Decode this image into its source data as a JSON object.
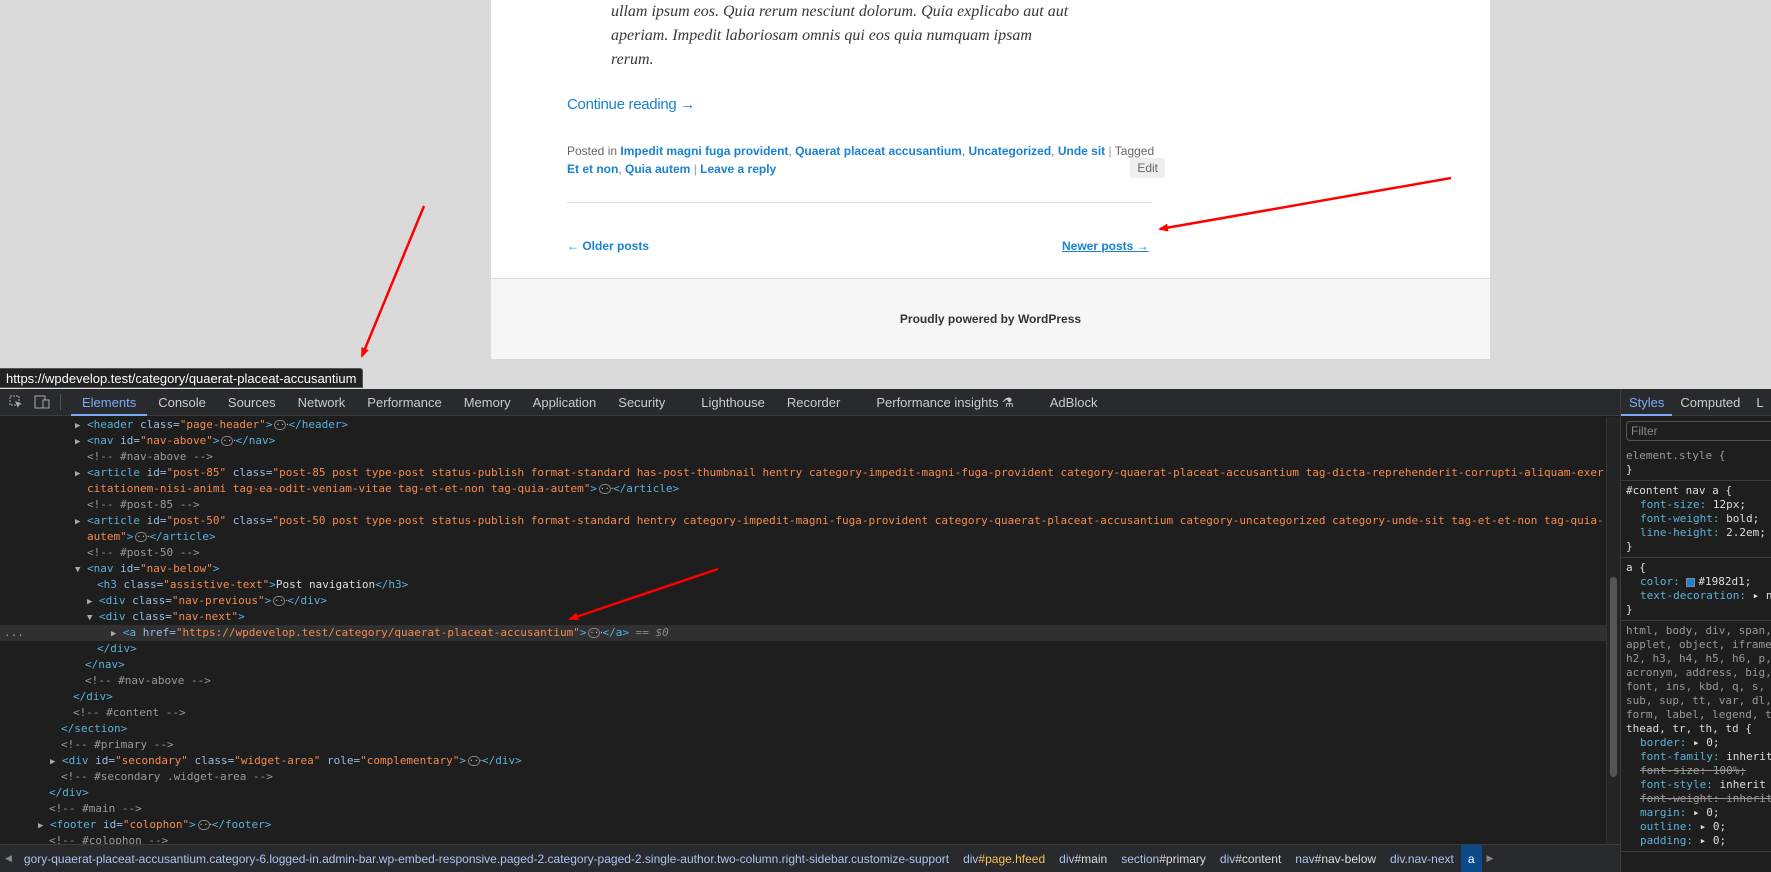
{
  "page": {
    "excerpt_lines": [
      "ullam ipsum eos. Quia rerum nesciunt dolorum. Quia explicabo aut aut",
      "aperiam. Impedit laboriosam omnis qui eos quia numquam ipsam",
      "rerum."
    ],
    "continue_reading": "Continue reading →",
    "meta": {
      "posted_in_label": "Posted in",
      "categories": [
        "Impedit magni fuga provident",
        "Quaerat placeat accusantium",
        "Uncategorized",
        "Unde sit"
      ],
      "tagged_label": "Tagged",
      "tags": [
        "Et et non",
        "Quia autem"
      ],
      "separator": "|",
      "leave_reply": "Leave a reply",
      "edit": "Edit"
    },
    "older_posts": "← Older posts",
    "newer_posts": "Newer posts →",
    "footer_text": "Proudly powered by WordPress",
    "link_color": "#1982d1"
  },
  "tooltip_url": "https://wpdevelop.test/category/quaerat-placeat-accusantium",
  "devtools": {
    "tabs": [
      "Elements",
      "Console",
      "Sources",
      "Network",
      "Performance",
      "Memory",
      "Application",
      "Security",
      "Lighthouse",
      "Recorder",
      "Performance insights",
      "AdBlock"
    ],
    "active_tab": "Elements",
    "dom": {
      "header_open": "<header",
      "header_class_attr": "class=",
      "header_class_val": "\"page-header\"",
      "header_close": "</header>",
      "nav_above_open": "<nav",
      "nav_above_id_attr": "id=",
      "nav_above_id_val": "\"nav-above\"",
      "nav_close": "</nav>",
      "cmt_nav_above": "<!-- #nav-above -->",
      "article85_open": "<article",
      "article85_id_attr": "id=",
      "article85_id_val": "\"post-85\"",
      "article85_class_attr": "class=",
      "article85_class_val_1": "\"post-85 post type-post status-publish format-standard has-post-thumbnail hentry category-impedit-magni-fuga-provident category-quaerat-placeat-accusantium tag-dicta-reprehenderit-corrupti-aliquam-exer",
      "article85_class_val_2": "citationem-nisi-animi tag-ea-odit-veniam-vitae tag-et-et-non tag-quia-autem\"",
      "article_close": "</article>",
      "cmt_post85": "<!-- #post-85 -->",
      "article50_id_val": "\"post-50\"",
      "article50_class_val_1": "\"post-50 post type-post status-publish format-standard hentry category-impedit-magni-fuga-provident category-quaerat-placeat-accusantium category-uncategorized category-unde-sit tag-et-et-non tag-quia-",
      "article50_class_val_2": "autem\"",
      "cmt_post50": "<!-- #post-50 -->",
      "nav_below_id_val": "\"nav-below\"",
      "h3_open": "<h3",
      "h3_class_val": "\"assistive-text\"",
      "h3_text": "Post navigation",
      "h3_close": "</h3>",
      "div_open": "<div",
      "nav_prev_class_val": "\"nav-previous\"",
      "div_close": "</div>",
      "nav_next_class_val": "\"nav-next\"",
      "a_open": "<a",
      "a_href_attr": "href=",
      "a_href_val": "\"https://wpdevelop.test/category/quaerat-placeat-accusantium\"",
      "a_close": "</a>",
      "selected_marker": "== $0",
      "cmt_content": "<!-- #content -->",
      "section_close": "</section>",
      "cmt_primary": "<!-- #primary -->",
      "secondary_id_val": "\"secondary\"",
      "secondary_class_val": "\"widget-area\"",
      "role_attr": "role=",
      "secondary_role_val": "\"complementary\"",
      "cmt_secondary": "<!-- #secondary .widget-area -->",
      "cmt_main": "<!-- #main -->",
      "footer_open": "<footer",
      "footer_id_val": "\"colophon\"",
      "footer_close": "</footer>",
      "cmt_colophon": "<!-- #colophon -->",
      "gutter_dots": "..."
    },
    "breadcrumbs": [
      {
        "label": "gory-quaerat-placeat-accusantium.category-6.logged-in.admin-bar.wp-embed-responsive.paged-2.category-paged-2.single-author.two-column.right-sidebar.customize-support",
        "hash": ""
      },
      {
        "label": "div",
        "hash": "#page.hfeed"
      },
      {
        "label": "div",
        "hash": "#main"
      },
      {
        "label": "section",
        "hash": "#primary"
      },
      {
        "label": "div",
        "hash": "#content"
      },
      {
        "label": "nav",
        "hash": "#nav-below"
      },
      {
        "label": "div.nav-next",
        "hash": ""
      },
      {
        "label": "a",
        "hash": ""
      }
    ],
    "styles": {
      "tabs": [
        "Styles",
        "Computed",
        "L"
      ],
      "filter_placeholder": "Filter",
      "rules": {
        "element_style": "element.style {",
        "close": "}",
        "content_nav_a": "#content nav a {",
        "p1_name": "font-size",
        "p1_val": "12px;",
        "p2_name": "font-weight",
        "p2_val": "bold;",
        "p3_name": "line-height",
        "p3_val": "2.2em;",
        "a_sel": "a {",
        "p4_name": "color",
        "p4_val": "#1982d1;",
        "p5_name": "text-decoration",
        "p5_val": "▸ n",
        "reset_sel_1": "html, body, div, span,",
        "reset_sel_2": "applet, object, iframe",
        "reset_sel_3": "h2, h3, h4, h5, h6, p,",
        "reset_sel_4": "acronym, address, big,",
        "reset_sel_5": "font, ins, kbd, q, s,",
        "reset_sel_6": "sub, sup, tt, var, dl,",
        "reset_sel_7": "form, label, legend, t",
        "reset_sel_8": "thead, tr, th, td {",
        "r1_name": "border",
        "r1_val": "▸ 0;",
        "r2_name": "font-family",
        "r2_val": "inherit",
        "r3_name": "font-size",
        "r3_val": "100%;",
        "r4_name": "font-style",
        "r4_val": "inherit",
        "r5_name": "font-weight",
        "r5_val": "inherit",
        "r6_name": "margin",
        "r6_val": "▸ 0;",
        "r7_name": "outline",
        "r7_val": "▸ 0;",
        "r8_name": "padding",
        "r8_val": "▸ 0;"
      }
    }
  }
}
